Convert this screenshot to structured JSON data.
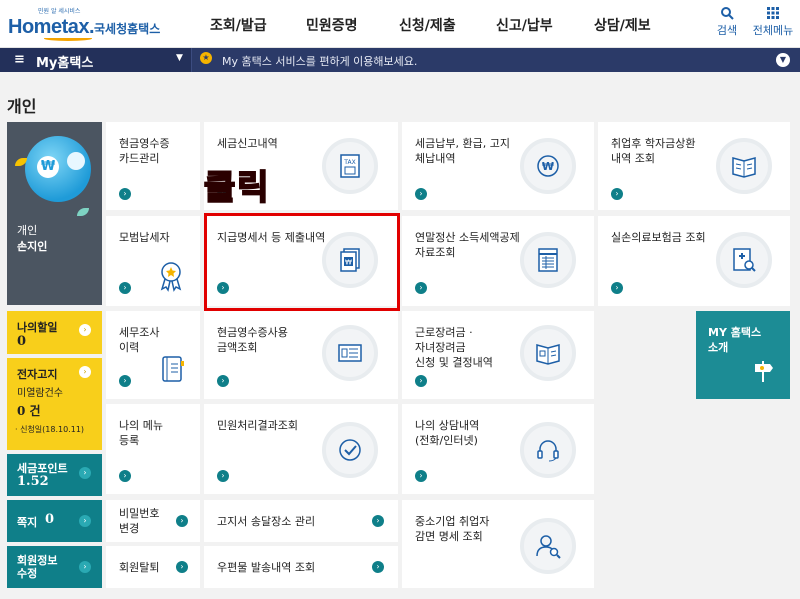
{
  "header": {
    "logo_sub": "민원 알 세시비스",
    "logo_main": "Hometax.",
    "logo_ko": "국세청홈택스",
    "nav": [
      "조회/발급",
      "민원증명",
      "신청/제출",
      "신고/납부",
      "상담/제보"
    ],
    "search_label": "검색",
    "all_menu_label": "전체메뉴"
  },
  "mybar": {
    "menu_icon": "≡",
    "title": "My홈택스",
    "message": "My 홈택스 서비스를 편하게 이용해보세요."
  },
  "section_title": "개인",
  "profile": {
    "type": "개인",
    "name": "손지인"
  },
  "side": {
    "discount_label": "나의할일",
    "discount_value": "0",
    "notice_label": "전자고지",
    "notice_sub": "미열람건수",
    "notice_value": "0 건",
    "notice_date": "· 신청일(18.10.11)",
    "points_label": "세금포인트",
    "points_value": "1.52",
    "message_label": "쪽지",
    "message_value": "0",
    "member_label": "회원정보\n수정"
  },
  "cards": {
    "cash_receipt_card": "현금영수증\n카드관리",
    "tax_report_history": "세금신고내역",
    "tax_payment_refund": "세금납부, 환급, 고지\n체납내역",
    "student_loan": "취업후 학자금상환\n내역 조회",
    "model_taxpayer": "모범납세자",
    "payment_statement": "지급명세서 등 제출내역",
    "year_end_settlement": "연말정산 소득세액공제\n자료조회",
    "medical_insurance": "실손의료보험금 조회",
    "tax_audit": "세무조사\n이력",
    "cash_receipt_usage": "현금영수증사용\n금액조회",
    "earned_income_credit": "근로장려금 ·\n자녀장려금\n신청 및 결정내역",
    "my_hometax": "MY 홈택스\n소개",
    "my_menu": "나의 메뉴\n등록",
    "civil_petition": "민원처리결과조회",
    "consult_history": "나의 상담내역\n(전화/인터넷)",
    "password_change": "비밀번호\n변경",
    "notice_address": "고지서 송달장소 관리",
    "sme_tax_exempt": "중소기업 취업자\n감면 명세 조회",
    "withdraw": "회원탈퇴",
    "mail_history": "우편물 발송내역 조회"
  },
  "annotation": "클릭",
  "colors": {
    "teal": "#0f7f89",
    "yellow": "#f8cf1b",
    "navy": "#2b3a68",
    "highlight_red": "#e10000"
  }
}
